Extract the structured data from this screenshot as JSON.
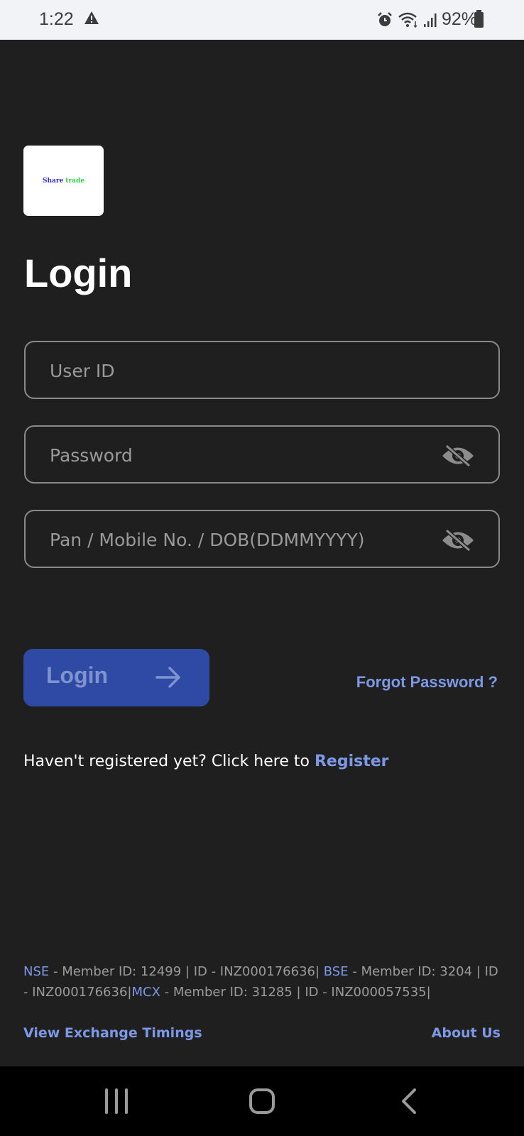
{
  "status_bar": {
    "time": "1:22",
    "battery": "92%",
    "icons": [
      "warning-icon",
      "alarm-icon",
      "wifi-icon",
      "signal-icon",
      "battery-icon"
    ]
  },
  "logo": {
    "part1": "Share",
    "part2": "trade"
  },
  "page": {
    "title": "Login"
  },
  "form": {
    "user_id": {
      "value": "",
      "placeholder": "User ID"
    },
    "password": {
      "value": "",
      "placeholder": "Password"
    },
    "pan": {
      "value": "",
      "placeholder": "Pan / Mobile No. / DOB(DDMMYYYY)"
    }
  },
  "actions": {
    "login_label": "Login",
    "forgot_label": "Forgot Password ?"
  },
  "register": {
    "prompt": "Haven't registered yet? Click here to ",
    "link_label": "Register"
  },
  "members": [
    {
      "exchange": "NSE",
      "text": " - Member ID: 12499 | ID - INZ000176636| "
    },
    {
      "exchange": "BSE",
      "text": " - Member ID: 3204 | ID - INZ000176636|"
    },
    {
      "exchange": "MCX",
      "text": " - Member ID: 31285 | ID - INZ000057535|"
    }
  ],
  "footer": {
    "left_link": "View Exchange Timings",
    "right_link": "About Us"
  },
  "colors": {
    "background": "#1f1f1f",
    "accent": "#7d99e6",
    "button": "#2f4aa5"
  }
}
